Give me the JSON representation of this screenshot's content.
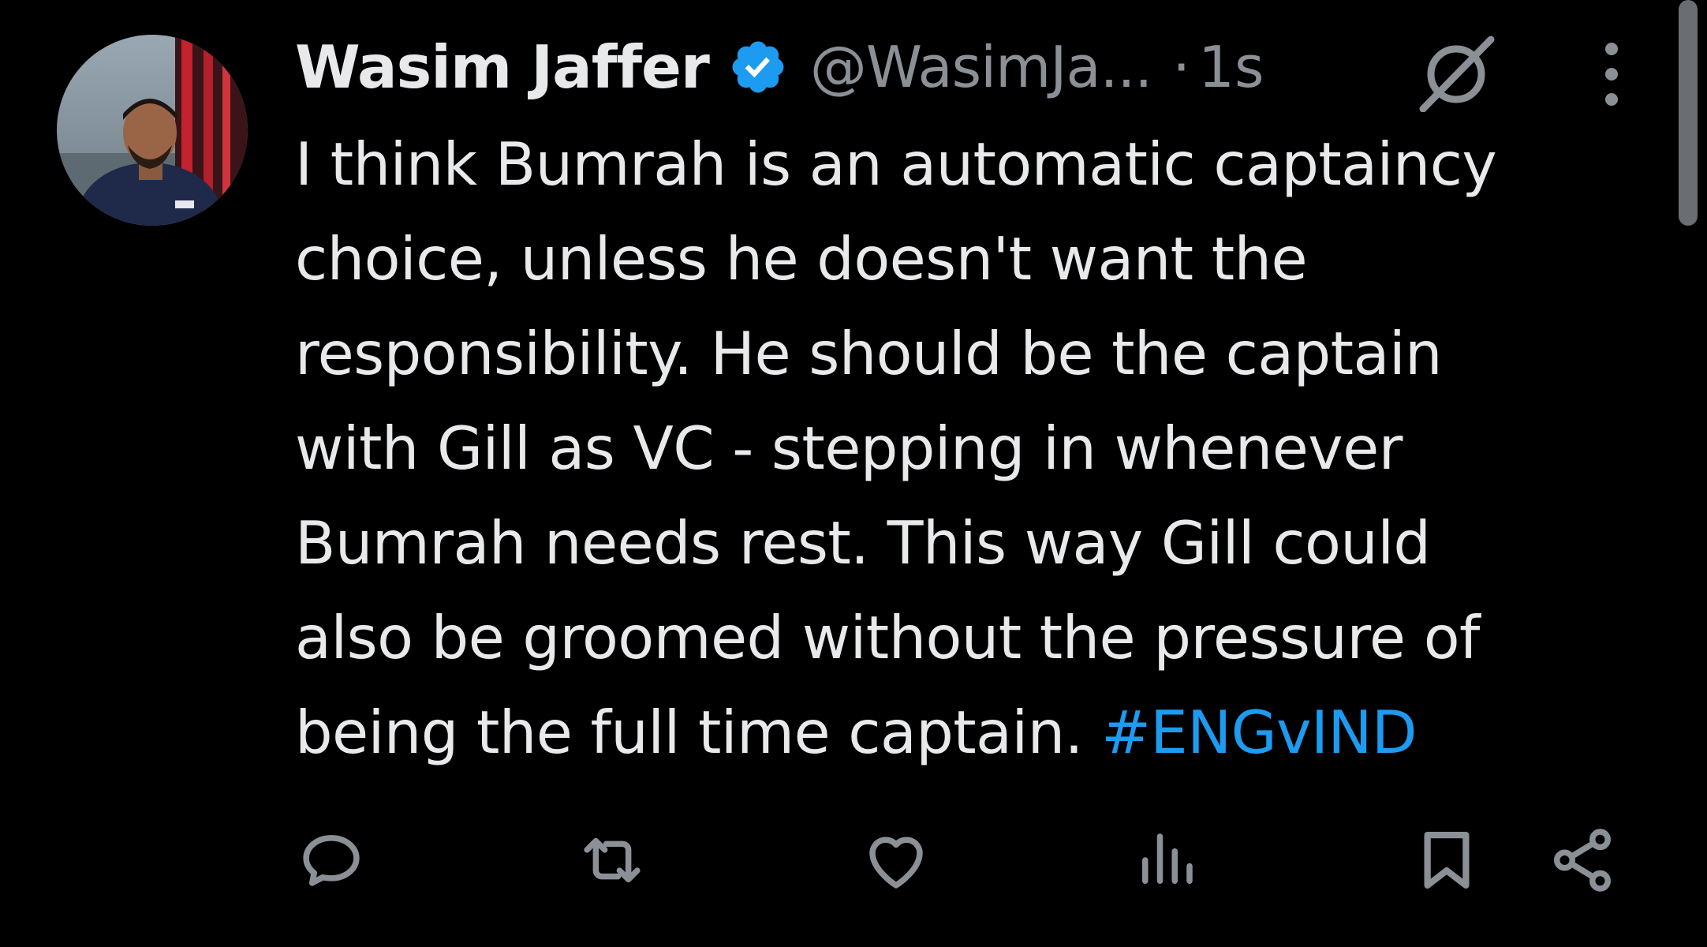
{
  "tweet": {
    "author": {
      "display_name": "Wasim Jaffer",
      "verified": true,
      "handle": "@WasimJa...",
      "avatar": "avatar-photo"
    },
    "separator": "·",
    "time": "1s",
    "text_lines": [
      "I think Bumrah is an automatic captaincy",
      "choice, unless he doesn't want the",
      "responsibility. He should be the captain",
      "with Gill as VC - stepping in whenever",
      "Bumrah needs rest. This way Gill could",
      "also be groomed without the pressure of",
      "being the full time captain. "
    ],
    "hashtag": "#ENGvIND",
    "header_icons": [
      "grok-icon",
      "more-options-icon"
    ],
    "actions": [
      {
        "name": "reply-button",
        "icon": "reply-icon"
      },
      {
        "name": "retweet-button",
        "icon": "retweet-icon"
      },
      {
        "name": "like-button",
        "icon": "heart-icon"
      },
      {
        "name": "views-button",
        "icon": "analytics-icon"
      },
      {
        "name": "bookmark-button",
        "icon": "bookmark-icon"
      },
      {
        "name": "share-button",
        "icon": "share-icon"
      }
    ]
  },
  "colors": {
    "background": "#000000",
    "text_primary": "#e7e9ea",
    "text_secondary": "#8b9096",
    "accent": "#1d9bf0",
    "icon": "#8b9096",
    "scrollbar": "#6a6d71"
  }
}
